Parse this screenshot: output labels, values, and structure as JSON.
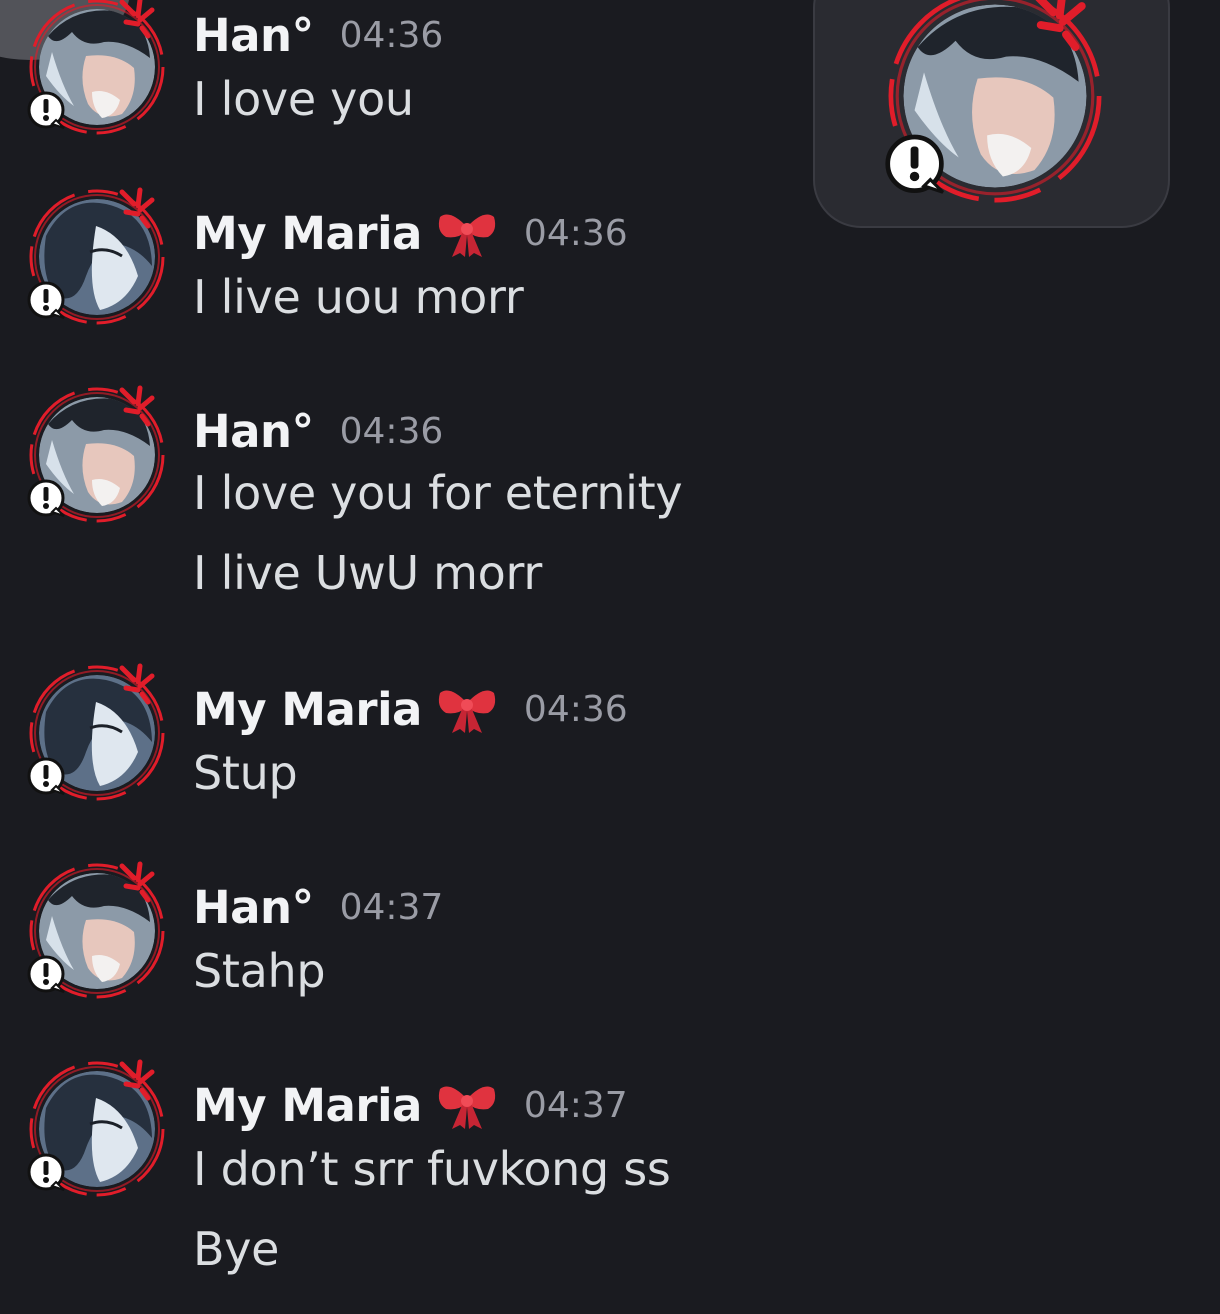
{
  "colors": {
    "background": "#1a1b20",
    "username": "#f2f3f5",
    "timestamp": "#9a9ca5",
    "message_text": "#dbdee1",
    "avatar_ring": "#e11d2a",
    "bow": "#e0333f"
  },
  "messages": [
    {
      "author": "Han°",
      "time": "04:36",
      "avatar_icon": "han-avatar-icon",
      "has_bow": false,
      "lines": [
        "I love you"
      ]
    },
    {
      "author": "My Maria",
      "time": "04:36",
      "avatar_icon": "maria-avatar-icon",
      "has_bow": true,
      "lines": [
        "I live uou morr"
      ]
    },
    {
      "author": "Han°",
      "time": "04:36",
      "avatar_icon": "han-avatar-icon",
      "has_bow": false,
      "lines": [
        "I love you for eternity",
        "I live UwU morr"
      ]
    },
    {
      "author": "My Maria",
      "time": "04:36",
      "avatar_icon": "maria-avatar-icon",
      "has_bow": true,
      "lines": [
        "Stup"
      ]
    },
    {
      "author": "Han°",
      "time": "04:37",
      "avatar_icon": "han-avatar-icon",
      "has_bow": false,
      "lines": [
        "Stahp"
      ]
    },
    {
      "author": "My Maria",
      "time": "04:37",
      "avatar_icon": "maria-avatar-icon",
      "has_bow": true,
      "lines": [
        "I don’t srr fuvkong ss",
        "Bye"
      ]
    }
  ],
  "floating_card": {
    "avatar_icon": "han-avatar-icon"
  }
}
